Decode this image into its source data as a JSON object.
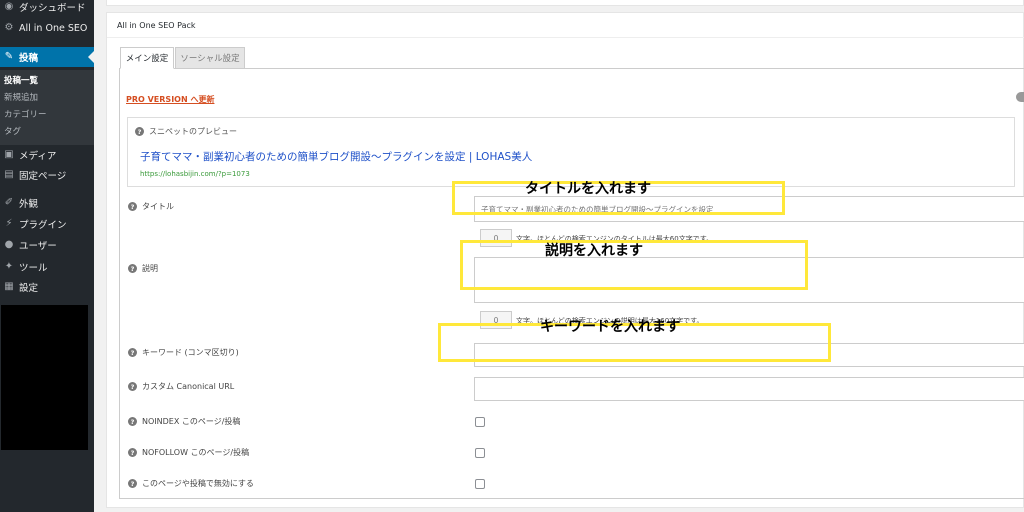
{
  "sidebar": {
    "items": [
      {
        "label": "ダッシュボード",
        "icon": "dashboard-icon"
      },
      {
        "label": "All in One SEO",
        "icon": "gear-icon"
      },
      {
        "label": "投稿",
        "icon": "pin-icon"
      },
      {
        "label": "メディア",
        "icon": "media-icon"
      },
      {
        "label": "固定ページ",
        "icon": "page-icon"
      },
      {
        "label": "外観",
        "icon": "brush-icon"
      },
      {
        "label": "プラグイン",
        "icon": "plugin-icon"
      },
      {
        "label": "ユーザー",
        "icon": "user-icon"
      },
      {
        "label": "ツール",
        "icon": "wrench-icon"
      },
      {
        "label": "設定",
        "icon": "settings-icon"
      }
    ],
    "submenu": [
      "投稿一覧",
      "新規追加",
      "カテゴリー",
      "タグ"
    ]
  },
  "panel": {
    "title": "All in One SEO Pack",
    "tabs": [
      "メイン設定",
      "ソーシャル設定"
    ],
    "pro_link": "PRO VERSION へ更新"
  },
  "snippet": {
    "label": "スニペットのプレビュー",
    "title": "子育てママ・副業初心者のための簡単ブログ開設～プラグインを設定 | LOHAS美人",
    "url": "https://lohasbijin.com/?p=1073"
  },
  "fields": {
    "title": {
      "label": "タイトル",
      "value": "子育てママ・副業初心者のための簡単ブログ開設～プラグインを設定",
      "count": "0",
      "note": "文字。ほとんどの検索エンジンのタイトルは最大60文字です。"
    },
    "description": {
      "label": "説明",
      "value": "",
      "count": "0",
      "note": "文字。ほとんどの検索エンジンの説明は最大160文字です。"
    },
    "keywords": {
      "label": "キーワード (コンマ区切り)",
      "value": ""
    },
    "canonical": {
      "label": "カスタム Canonical URL",
      "value": ""
    },
    "noindex": {
      "label": "NOINDEX このページ/投稿"
    },
    "nofollow": {
      "label": "NOFOLLOW このページ/投稿"
    },
    "disable": {
      "label": "このページや投稿で無効にする"
    }
  },
  "annotations": {
    "title": "タイトルを入れます",
    "description": "説明を入れます",
    "keywords": "キーワードを入れます"
  },
  "colors": {
    "sidebar_bg": "#23282d",
    "active_bg": "#0073aa",
    "pro_link": "#d54e21",
    "snippet_title": "#1e50c8",
    "snippet_url": "#3a9a3a",
    "highlight": "#ffe83a"
  }
}
